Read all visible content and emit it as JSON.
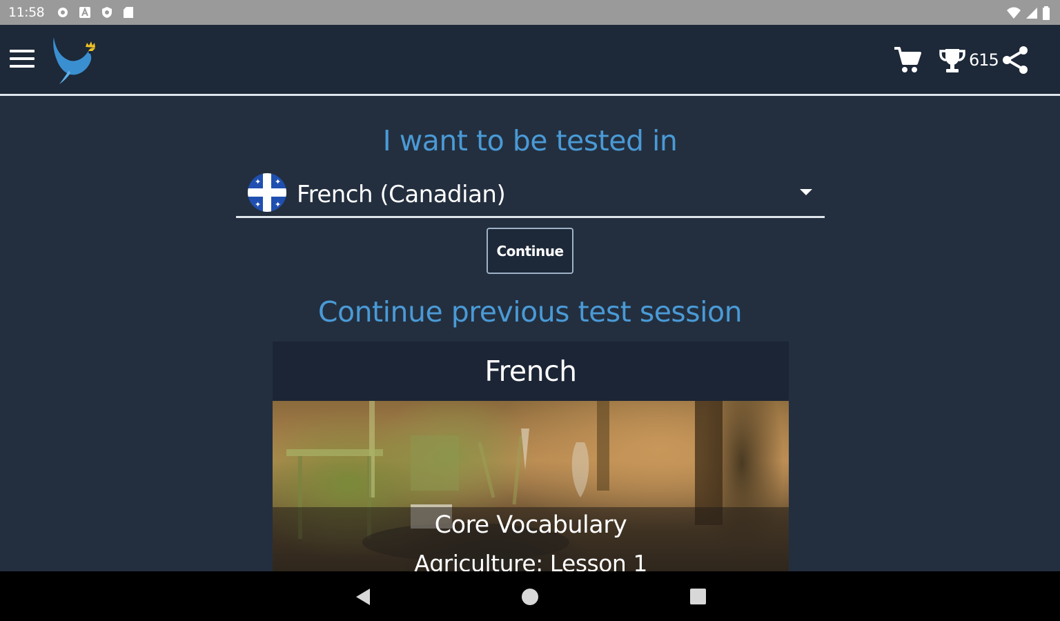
{
  "status_bar": {
    "time": "11:58",
    "left_icons": [
      "settings-icon",
      "a-icon",
      "shield-icon",
      "sd-card-icon"
    ],
    "right_icons": [
      "wifi-icon",
      "signal-icon",
      "battery-icon"
    ]
  },
  "app_bar": {
    "menu_icon": "hamburger-menu-icon",
    "logo": "bird-logo",
    "points": "615",
    "actions": [
      "cart-icon",
      "trophy-icon",
      "share-icon"
    ]
  },
  "test_selection": {
    "heading": "I want to be tested in",
    "selected_language": "French (Canadian)",
    "flag": "quebec-flag",
    "continue_label": "Continue"
  },
  "previous_session": {
    "heading": "Continue previous test session",
    "card": {
      "title": "French",
      "category": "Core Vocabulary",
      "lesson": "Agriculture: Lesson 1"
    }
  },
  "nav_bar": {
    "buttons": [
      "back-icon",
      "home-icon",
      "recents-icon"
    ]
  },
  "colors": {
    "background": "#232f3f",
    "app_bar": "#1d2838",
    "accent_text": "#4a9ad6",
    "status_bar": "#9a9a9a"
  }
}
